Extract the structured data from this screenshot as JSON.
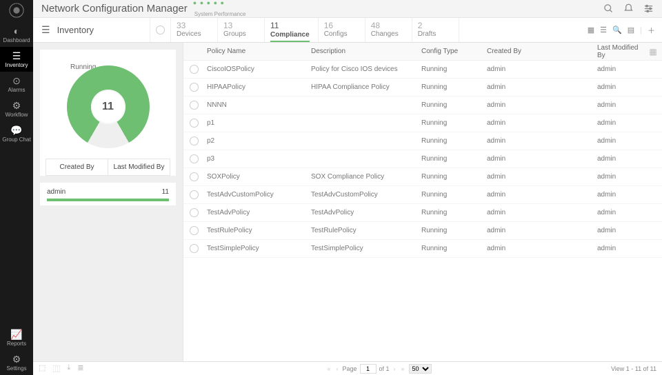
{
  "app": {
    "title": "Network Configuration Manager",
    "subtitle": "System Performance"
  },
  "nav": {
    "items": [
      {
        "id": "dashboard",
        "label": "Dashboard",
        "icon": "◐"
      },
      {
        "id": "inventory",
        "label": "Inventory",
        "icon": "☰",
        "active": true
      },
      {
        "id": "alarms",
        "label": "Alarms",
        "icon": "⊙"
      },
      {
        "id": "workflow",
        "label": "Workflow",
        "icon": "⚙"
      },
      {
        "id": "groupchat",
        "label": "Group Chat",
        "icon": "💬"
      }
    ],
    "bottom": [
      {
        "id": "reports",
        "label": "Reports",
        "icon": "📈"
      },
      {
        "id": "settings",
        "label": "Settings",
        "icon": "⚙"
      }
    ]
  },
  "page_title": "Inventory",
  "tabs": [
    {
      "count": "33",
      "label": "Devices"
    },
    {
      "count": "13",
      "label": "Groups"
    },
    {
      "count": "11",
      "label": "Compliance",
      "active": true
    },
    {
      "count": "16",
      "label": "Configs"
    },
    {
      "count": "48",
      "label": "Changes"
    },
    {
      "count": "2",
      "label": "Drafts"
    }
  ],
  "chart_data": {
    "type": "pie",
    "title": "Running",
    "total": 11,
    "categories": [
      "Running"
    ],
    "values": [
      11
    ],
    "series": [
      {
        "name": "Running",
        "values": [
          11
        ],
        "color": "#6fbf73"
      }
    ]
  },
  "side": {
    "toggle": {
      "a": "Created By",
      "b": "Last Modified By"
    },
    "summary": {
      "name": "admin",
      "count": "11"
    }
  },
  "table": {
    "headers": {
      "name": "Policy Name",
      "desc": "Description",
      "type": "Config Type",
      "created": "Created By",
      "modified": "Last Modified By"
    },
    "rows": [
      {
        "name": "CiscoIOSPolicy",
        "desc": "Policy for Cisco IOS devices",
        "type": "Running",
        "created": "admin",
        "modified": "admin"
      },
      {
        "name": "HIPAAPolicy",
        "desc": "HIPAA Compliance Policy",
        "type": "Running",
        "created": "admin",
        "modified": "admin"
      },
      {
        "name": "NNNN",
        "desc": "",
        "type": "Running",
        "created": "admin",
        "modified": "admin"
      },
      {
        "name": "p1",
        "desc": "",
        "type": "Running",
        "created": "admin",
        "modified": "admin"
      },
      {
        "name": "p2",
        "desc": "",
        "type": "Running",
        "created": "admin",
        "modified": "admin"
      },
      {
        "name": "p3",
        "desc": "",
        "type": "Running",
        "created": "admin",
        "modified": "admin"
      },
      {
        "name": "SOXPolicy",
        "desc": "SOX Compliance Policy",
        "type": "Running",
        "created": "admin",
        "modified": "admin"
      },
      {
        "name": "TestAdvCustomPolicy",
        "desc": "TestAdvCustomPolicy",
        "type": "Running",
        "created": "admin",
        "modified": "admin"
      },
      {
        "name": "TestAdvPolicy",
        "desc": "TestAdvPolicy",
        "type": "Running",
        "created": "admin",
        "modified": "admin"
      },
      {
        "name": "TestRulePolicy",
        "desc": "TestRulePolicy",
        "type": "Running",
        "created": "admin",
        "modified": "admin"
      },
      {
        "name": "TestSimplePolicy",
        "desc": "TestSimplePolicy",
        "type": "Running",
        "created": "admin",
        "modified": "admin"
      }
    ]
  },
  "footer": {
    "page_label": "Page",
    "page": "1",
    "of": "of 1",
    "size": "50",
    "view": "View 1 - 11 of 11"
  }
}
